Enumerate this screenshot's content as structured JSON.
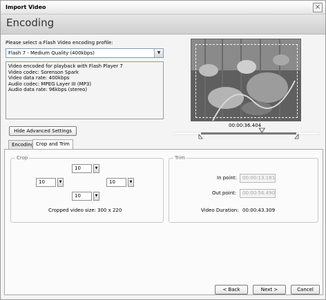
{
  "window": {
    "title": "Import Video",
    "close_glyph": "×"
  },
  "page_title": "Encoding",
  "profile": {
    "prompt": "Please select a Flash Video encoding profile:",
    "selected": "Flash 7 - Medium Quality (400kbps)",
    "description_lines": [
      "Video encoded for playback with Flash Player 7",
      "Video codec: Sorenson Spark",
      "Video data rate: 400kbps",
      "Audio codec: MPEG Layer III (MP3)",
      "Audio data rate: 96kbps (stereo)"
    ]
  },
  "advanced_button": "Hide Advanced Settings",
  "scrubber": {
    "current_time": "00:00:36.404",
    "playhead_fraction": 0.64
  },
  "tabs": [
    {
      "label": "Encoding",
      "active": false
    },
    {
      "label": "Crop and Trim",
      "active": true
    }
  ],
  "crop": {
    "legend": "Crop",
    "top": "10",
    "left": "10",
    "right": "10",
    "bottom": "10",
    "size_label": "Cropped video size:",
    "size_value": "300 x 220"
  },
  "trim": {
    "legend": "Trim",
    "in_label": "In point:",
    "in_value": "00:00:13.181",
    "out_label": "Out point:",
    "out_value": "00:00:56.490",
    "duration_label": "Video Duration:",
    "duration_value": "00:00:43.309"
  },
  "buttons": {
    "back": "< Back",
    "next": "Next >",
    "cancel": "Cancel"
  },
  "colors": {
    "header_band": "#d6d6d6",
    "scrub_track": "#7a7a7a",
    "window_bg": "#f4f4f4"
  }
}
